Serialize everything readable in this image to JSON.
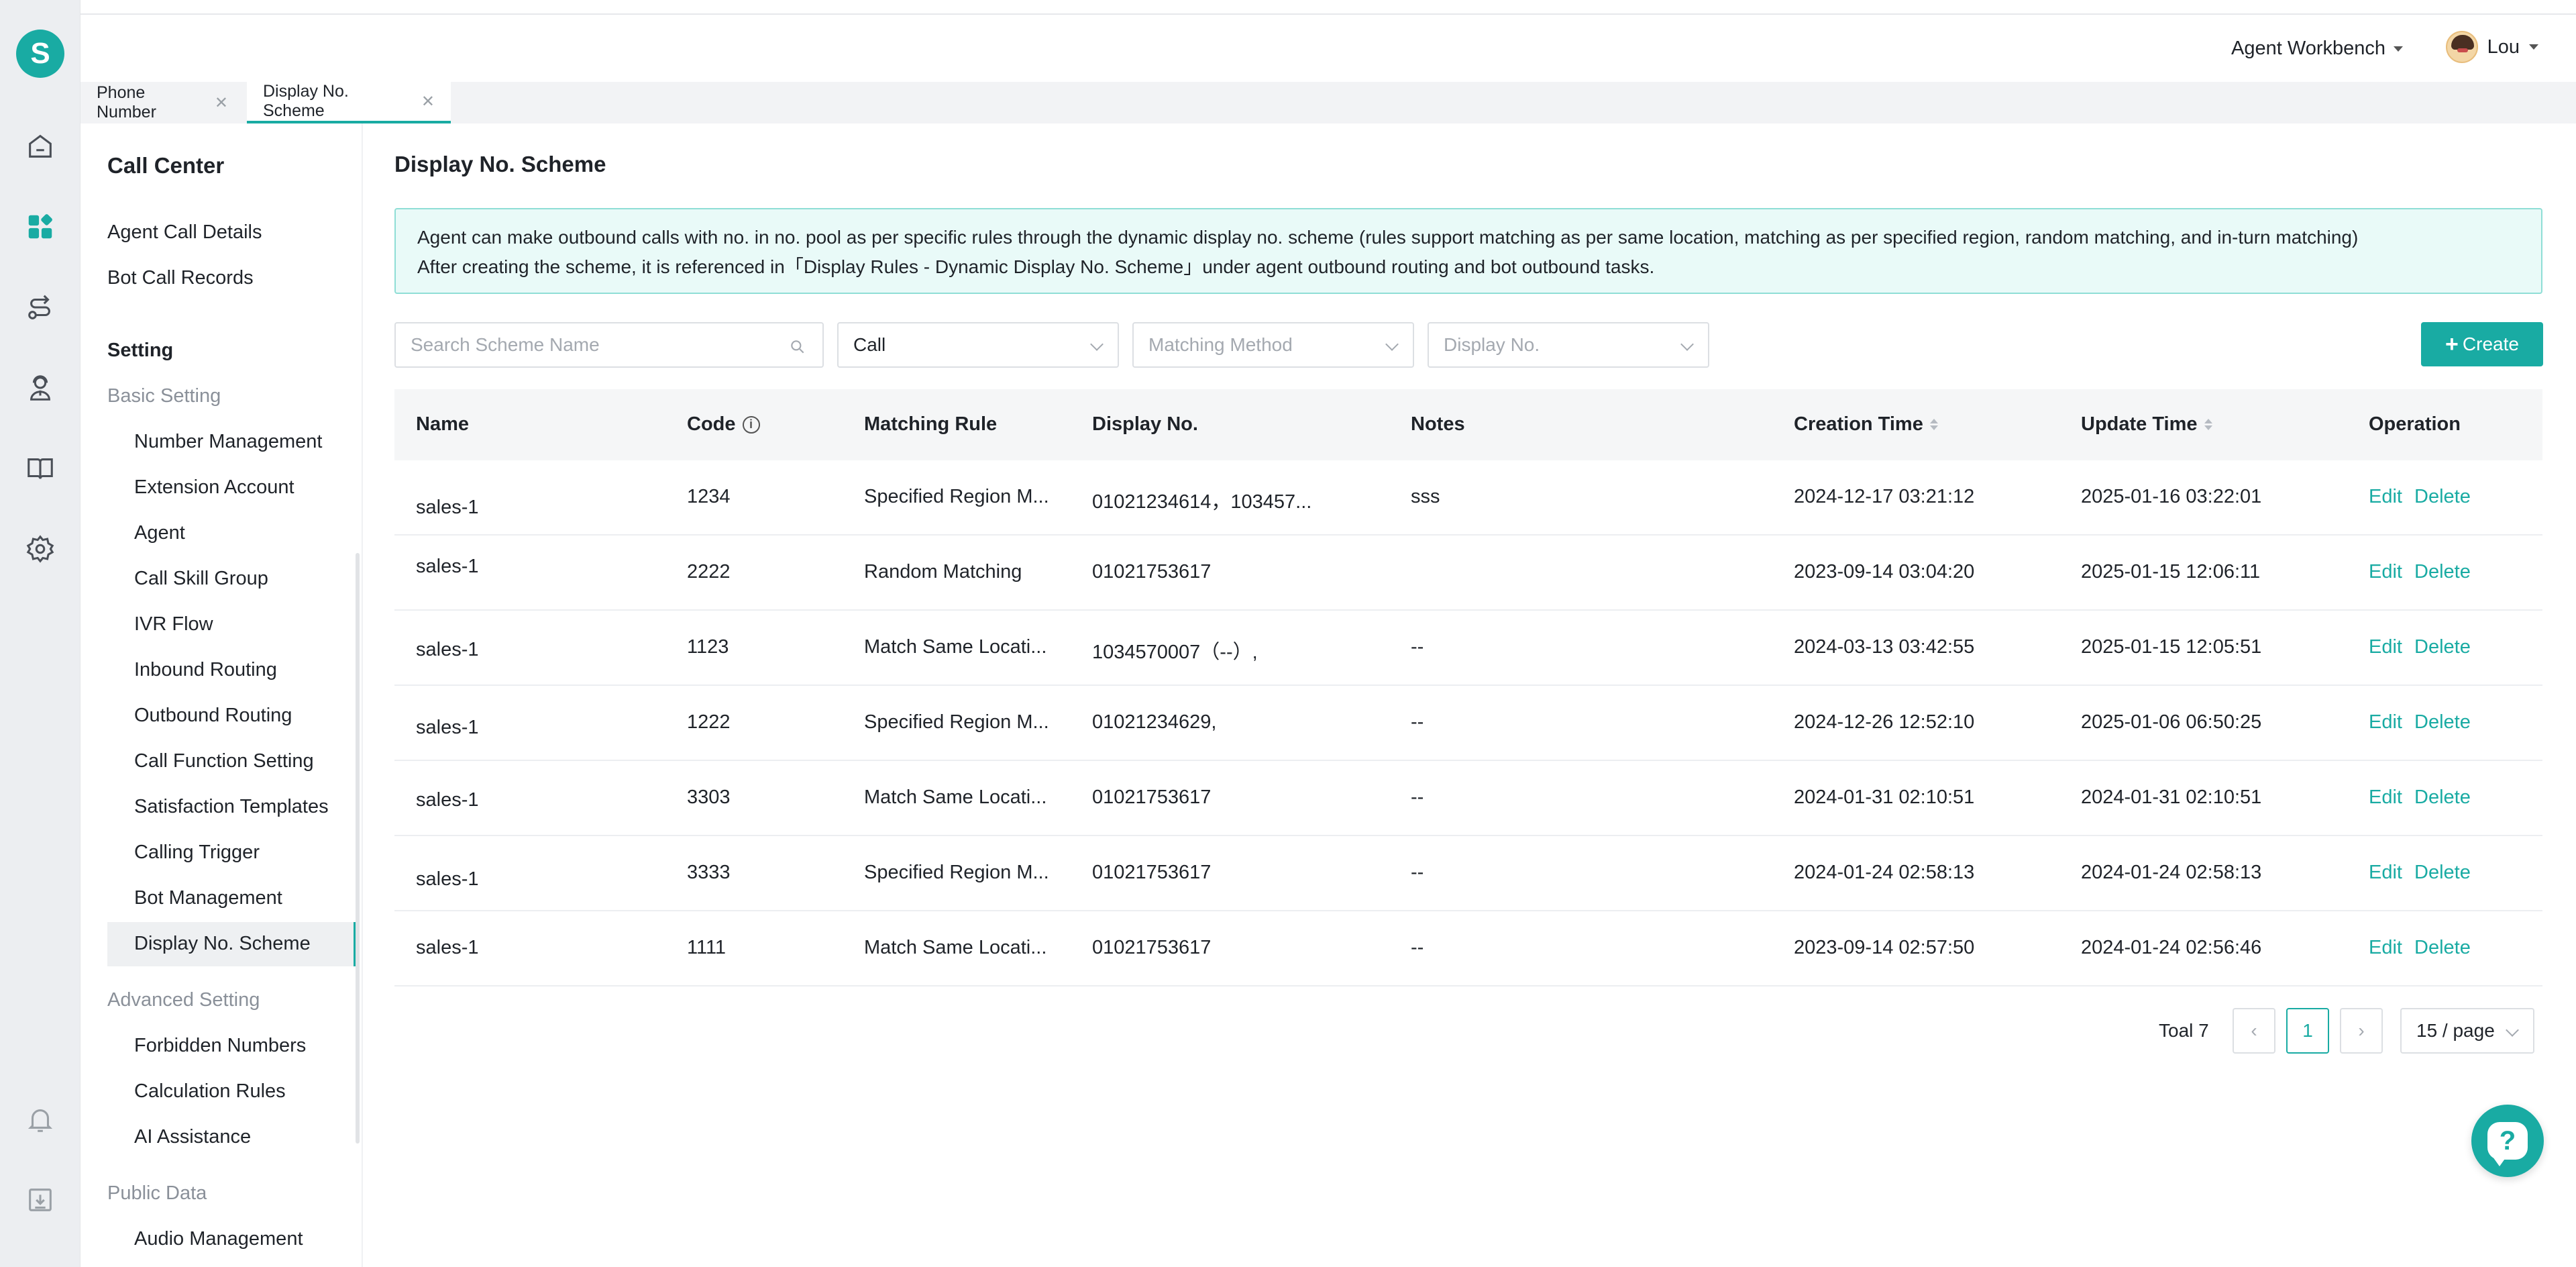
{
  "brand": {
    "logo_letter": "S",
    "accent": "#19aba3"
  },
  "rail": {
    "icons": [
      "home-icon",
      "dashboard-icon",
      "route-icon",
      "agent-icon",
      "book-icon",
      "gear-icon",
      "bell-icon",
      "download-icon"
    ]
  },
  "header": {
    "workbench_label": "Agent Workbench",
    "user_name": "Lou"
  },
  "tabs": [
    {
      "label": "Phone Number",
      "active": false
    },
    {
      "label": "Display No. Scheme",
      "active": true
    }
  ],
  "sidebar": {
    "title": "Call Center",
    "top_items": [
      "Agent Call Details",
      "Bot Call Records"
    ],
    "section_title": "Setting",
    "groups": [
      {
        "label": "Basic Setting",
        "items": [
          "Number Management",
          "Extension Account",
          "Agent",
          "Call Skill Group",
          "IVR Flow",
          "Inbound Routing",
          "Outbound Routing",
          "Call Function Setting",
          "Satisfaction Templates",
          "Calling Trigger",
          "Bot Management",
          "Display No. Scheme"
        ]
      },
      {
        "label": "Advanced Setting",
        "items": [
          "Forbidden Numbers",
          "Calculation Rules",
          "AI Assistance"
        ]
      },
      {
        "label": "Public Data",
        "items": [
          "Audio Management"
        ]
      }
    ],
    "active_item": "Display No. Scheme"
  },
  "main": {
    "title": "Display No. Scheme",
    "notice_line1": "Agent can make outbound calls with no. in no. pool as per specific rules through the dynamic display no. scheme (rules support matching as per same location, matching as per specified region, random matching, and in-turn matching)",
    "notice_line2": "After creating the scheme, it is referenced in「Display Rules - Dynamic Display No. Scheme」under agent outbound routing and bot outbound tasks.",
    "filters": {
      "search_placeholder": "Search Scheme Name",
      "type_value": "Call",
      "matching_placeholder": "Matching Method",
      "display_placeholder": "Display No."
    },
    "create_label": "Create"
  },
  "table": {
    "columns": [
      "Name",
      "Code",
      "Matching Rule",
      "Display No.",
      "Notes",
      "Creation Time",
      "Update Time",
      "Operation"
    ],
    "rows": [
      {
        "name": "sales-1",
        "code": "1234",
        "rule": "Specified Region M...",
        "display": "01021234614，103457...",
        "notes": "sss",
        "created": "2024-12-17 03:21:12",
        "updated": "2025-01-16 03:22:01"
      },
      {
        "name": "sales-1",
        "code": "2222",
        "rule": "Random Matching",
        "display": "01021753617",
        "notes": "",
        "created": "2023-09-14 03:04:20",
        "updated": "2025-01-15 12:06:11"
      },
      {
        "name": "sales-1",
        "code": "1123",
        "rule": "Match Same Locati...",
        "display": "1034570007（--）,",
        "notes": "--",
        "created": "2024-03-13 03:42:55",
        "updated": "2025-01-15 12:05:51"
      },
      {
        "name": "sales-1",
        "code": "1222",
        "rule": "Specified Region M...",
        "display": "01021234629,",
        "notes": "--",
        "created": "2024-12-26 12:52:10",
        "updated": "2025-01-06 06:50:25"
      },
      {
        "name": "sales-1",
        "code": "3303",
        "rule": "Match Same Locati...",
        "display": "01021753617",
        "notes": "--",
        "created": "2024-01-31 02:10:51",
        "updated": "2024-01-31 02:10:51"
      },
      {
        "name": "sales-1",
        "code": "3333",
        "rule": "Specified Region M...",
        "display": "01021753617",
        "notes": "--",
        "created": "2024-01-24 02:58:13",
        "updated": "2024-01-24 02:58:13"
      },
      {
        "name": "sales-1",
        "code": "1111",
        "rule": "Match Same Locati...",
        "display": "01021753617",
        "notes": "--",
        "created": "2023-09-14 02:57:50",
        "updated": "2024-01-24 02:56:46"
      }
    ],
    "edit_label": "Edit",
    "delete_label": "Delete"
  },
  "pagination": {
    "total_label": "Toal 7",
    "current_page": "1",
    "page_size": "15 / page"
  },
  "help_label": "?"
}
